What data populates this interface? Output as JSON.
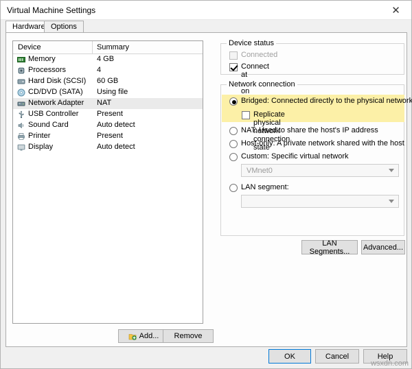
{
  "window": {
    "title": "Virtual Machine Settings",
    "close_icon": "close-icon"
  },
  "tabs": [
    {
      "label": "Hardware",
      "active": true
    },
    {
      "label": "Options",
      "active": false
    }
  ],
  "device_list": {
    "columns": [
      "Device",
      "Summary"
    ],
    "rows": [
      {
        "icon": "memory-icon",
        "name": "Memory",
        "summary": "4 GB",
        "selected": false
      },
      {
        "icon": "cpu-icon",
        "name": "Processors",
        "summary": "4",
        "selected": false
      },
      {
        "icon": "disk-icon",
        "name": "Hard Disk (SCSI)",
        "summary": "60 GB",
        "selected": false
      },
      {
        "icon": "cd-icon",
        "name": "CD/DVD (SATA)",
        "summary": "Using file",
        "selected": false
      },
      {
        "icon": "network-icon",
        "name": "Network Adapter",
        "summary": "NAT",
        "selected": true
      },
      {
        "icon": "usb-icon",
        "name": "USB Controller",
        "summary": "Present",
        "selected": false
      },
      {
        "icon": "sound-icon",
        "name": "Sound Card",
        "summary": "Auto detect",
        "selected": false
      },
      {
        "icon": "printer-icon",
        "name": "Printer",
        "summary": "Present",
        "selected": false
      },
      {
        "icon": "display-icon",
        "name": "Display",
        "summary": "Auto detect",
        "selected": false
      }
    ],
    "add_label": "Add...",
    "remove_label": "Remove"
  },
  "device_status": {
    "group_label": "Device status",
    "connected": {
      "label": "Connected",
      "checked": false,
      "disabled": true
    },
    "connect_at_power_on": {
      "label": "Connect at power on",
      "checked": true,
      "disabled": false
    }
  },
  "network_connection": {
    "group_label": "Network connection",
    "options": [
      {
        "label": "Bridged: Connected directly to the physical network",
        "selected": true
      },
      {
        "label": "NAT: Used to share the host's IP address",
        "selected": false
      },
      {
        "label": "Host-only: A private network shared with the host",
        "selected": false
      },
      {
        "label": "Custom: Specific virtual network",
        "selected": false
      },
      {
        "label": "LAN segment:",
        "selected": false
      }
    ],
    "replicate": {
      "label": "Replicate physical network connection state",
      "checked": false
    },
    "custom_combo_value": "VMnet0",
    "lan_combo_value": "",
    "lan_segments_label": "LAN Segments...",
    "advanced_label": "Advanced..."
  },
  "footer": {
    "ok_label": "OK",
    "cancel_label": "Cancel",
    "help_label": "Help",
    "watermark": "wsxdn.com"
  }
}
